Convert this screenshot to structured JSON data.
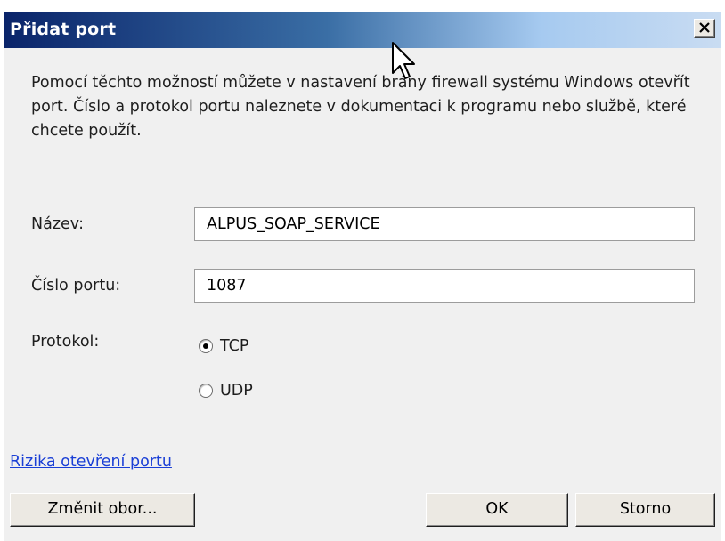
{
  "dialog": {
    "title": "Přidat port",
    "close_symbol": "✕",
    "description": "Pomocí těchto možností můžete v nastavení brány firewall systému Windows otevřít port. Číslo a protokol portu naleznete v dokumentaci k programu nebo službě, které chcete použít."
  },
  "form": {
    "name_label": "Název:",
    "name_value": "ALPUS_SOAP_SERVICE",
    "port_label": "Číslo portu:",
    "port_value": "1087",
    "protocol_label": "Protokol:",
    "protocol_options": [
      {
        "label": "TCP",
        "selected": true
      },
      {
        "label": "UDP",
        "selected": false
      }
    ]
  },
  "link": {
    "risks_text": "Rizika otevření portu"
  },
  "buttons": {
    "change_scope": "Změnit obor...",
    "ok": "OK",
    "cancel": "Storno"
  },
  "icons": {
    "close": "close-icon",
    "cursor": "mouse-pointer-icon"
  }
}
